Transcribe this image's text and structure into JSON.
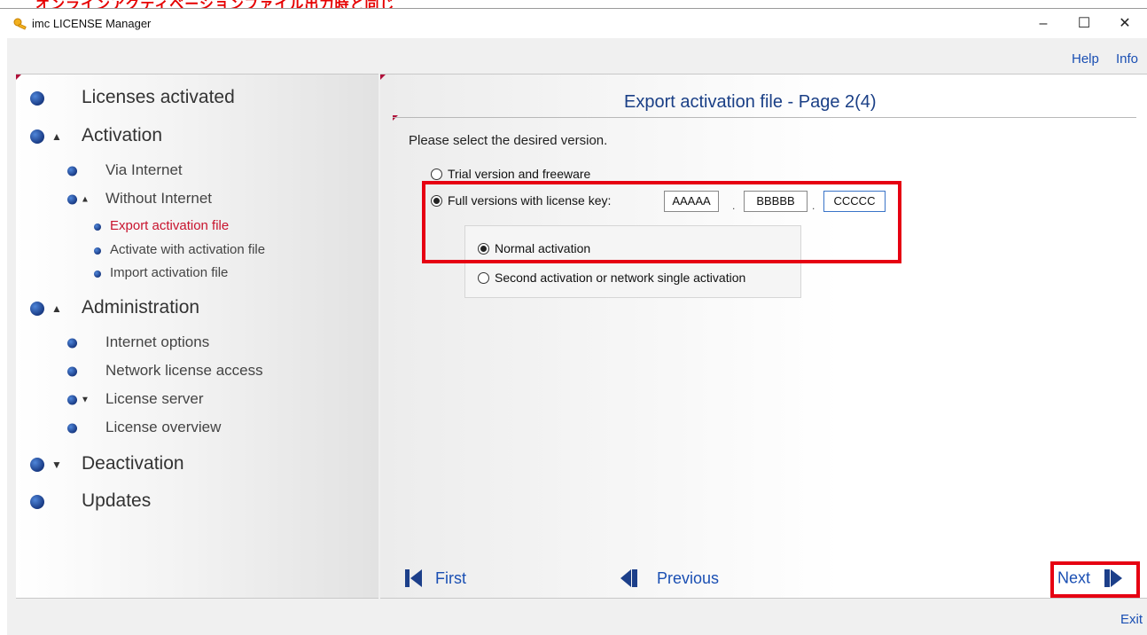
{
  "window": {
    "title": "imc LICENSE Manager",
    "top_annotation": "オンラインアクティベーションファイル出力時と同じ"
  },
  "header_links": {
    "help": "Help",
    "info": "Info"
  },
  "nav": {
    "licenses_activated": "Licenses activated",
    "activation": "Activation",
    "via_internet": "Via Internet",
    "without_internet": "Without Internet",
    "export_activation_file": "Export activation file",
    "activate_with_activation_file": "Activate with activation file",
    "import_activation_file": "Import activation file",
    "administration": "Administration",
    "internet_options": "Internet options",
    "network_license_access": "Network license access",
    "license_server": "License server",
    "license_overview": "License overview",
    "deactivation": "Deactivation",
    "updates": "Updates"
  },
  "main": {
    "page_title": "Export activation file - Page 2(4)",
    "prompt": "Please select the desired version.",
    "options": {
      "trial": "Trial version and freeware",
      "full": "Full versions with license key:"
    },
    "license_key": [
      "AAAAA",
      "BBBBB",
      "CCCCC"
    ],
    "key_separator": ".",
    "activation": {
      "normal": "Normal activation",
      "second": "Second activation or network single activation"
    }
  },
  "footer": {
    "first": "First",
    "previous": "Previous",
    "next": "Next",
    "exit": "Exit"
  },
  "colors": {
    "link": "#1a4fb3",
    "active_nav": "#c8142e",
    "highlight": "#e60012",
    "bullet": "#1c3f8a"
  }
}
